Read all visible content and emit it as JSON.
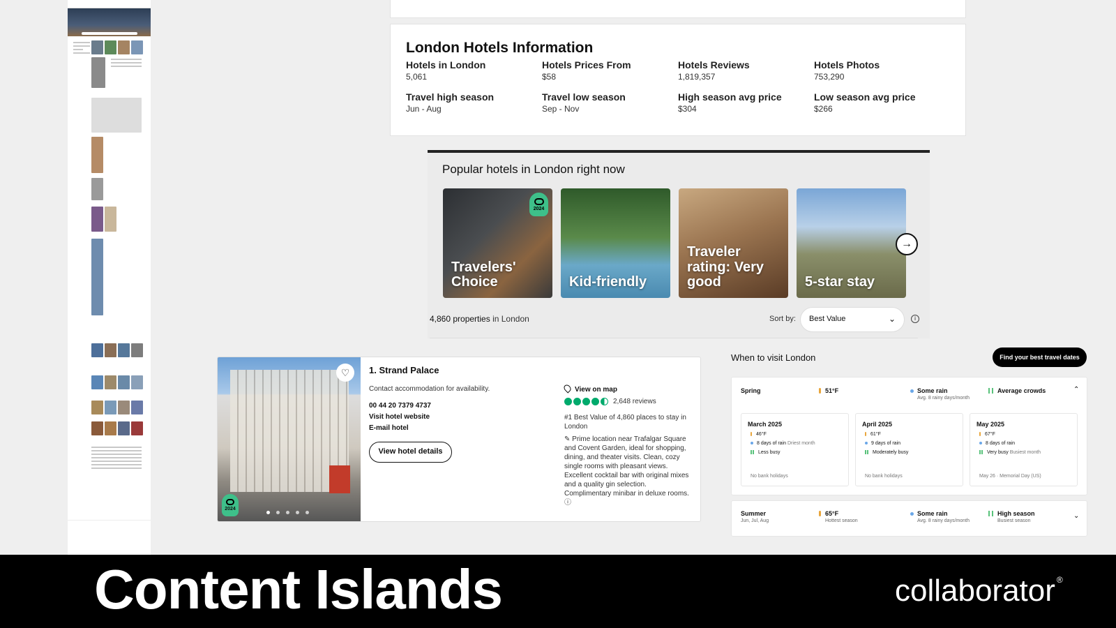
{
  "info": {
    "title": "London Hotels Information",
    "items": [
      {
        "label": "Hotels in London",
        "value": "5,061"
      },
      {
        "label": "Hotels Prices From",
        "value": "$58"
      },
      {
        "label": "Hotels Reviews",
        "value": "1,819,357"
      },
      {
        "label": "Hotels Photos",
        "value": "753,290"
      },
      {
        "label": "Travel high season",
        "value": "Jun - Aug"
      },
      {
        "label": "Travel low season",
        "value": "Sep - Nov"
      },
      {
        "label": "High season avg price",
        "value": "$304"
      },
      {
        "label": "Low season avg price",
        "value": "$266"
      }
    ]
  },
  "popular": {
    "title": "Popular hotels in London right now",
    "tiles": [
      {
        "label": "Travelers' Choice",
        "badge": "2024"
      },
      {
        "label": "Kid-friendly"
      },
      {
        "label": "Traveler rating: Very good"
      },
      {
        "label": "5-star stay"
      }
    ]
  },
  "properties": {
    "count": "4,860 properties",
    "location": "in London",
    "sort_label": "Sort by:",
    "sort_value": "Best Value"
  },
  "hotel": {
    "name": "1. Strand Palace",
    "availability": "Contact accommodation for availability.",
    "phone": "00 44 20 7379 4737",
    "website": "Visit hotel website",
    "email": "E-mail hotel",
    "details_button": "View hotel details",
    "map_link": "View on map",
    "rating": 4.5,
    "reviews": "2,648 reviews",
    "best_value": "#1 Best Value of 4,860 places to stay in London",
    "description": "Prime location near Trafalgar Square and Covent Garden, ideal for shopping, dining, and theater visits. Clean, cozy single rooms with pleasant views. Excellent cocktail bar with original mixes and a quality gin selection. Complimentary minibar in deluxe rooms.",
    "badge": "2024",
    "photo_count": 5
  },
  "visit": {
    "title": "When to visit London",
    "button": "Find your best travel dates",
    "spring": {
      "name": "Spring",
      "temp": "51°F",
      "rain": "Some rain",
      "rain_sub": "Avg. 8 rainy days/month",
      "crowds": "Average crowds",
      "months": [
        {
          "name": "March 2025",
          "temp": "46°F",
          "rain": "8 days of rain",
          "rain_sub": "Driest month",
          "crowd": "Less busy",
          "foot": "No bank holidays"
        },
        {
          "name": "April 2025",
          "temp": "61°F",
          "rain": "9 days of rain",
          "rain_sub": "",
          "crowd": "Moderately busy",
          "foot": "No bank holidays"
        },
        {
          "name": "May 2025",
          "temp": "67°F",
          "rain": "8 days of rain",
          "rain_sub": "",
          "crowd": "Very busy",
          "crowd_sub": "Busiest month",
          "foot": "May 26 · Memorial Day (US)"
        }
      ]
    },
    "summer": {
      "name": "Summer",
      "sub": "Jun, Jul, Aug",
      "temp": "65°F",
      "temp_sub": "Hottest season",
      "rain": "Some rain",
      "rain_sub": "Avg. 8 rainy days/month",
      "crowds": "High season",
      "crowds_sub": "Busiest season"
    }
  },
  "banner": {
    "title": "Content Islands",
    "logo": "collaborator",
    "logo_mark": "®"
  },
  "colors": {
    "brand_green": "#00aa6c",
    "badge_green": "#3ec08a",
    "banner_bg": "#000000"
  }
}
